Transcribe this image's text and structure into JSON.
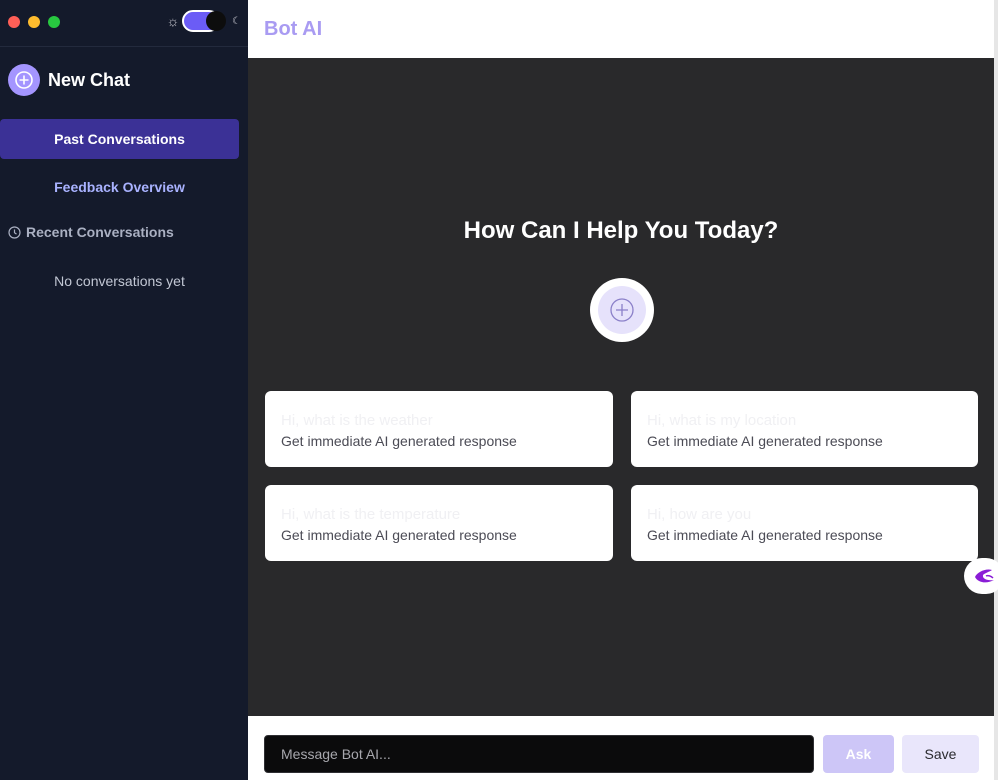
{
  "sidebar": {
    "new_chat": "New Chat",
    "nav": {
      "past": "Past Conversations",
      "feedback": "Feedback Overview"
    },
    "recent_label": "Recent Conversations",
    "empty": "No conversations yet",
    "theme": {
      "mode": "dark"
    }
  },
  "header": {
    "title": "Bot AI"
  },
  "main": {
    "heading": "How Can I Help You Today?",
    "cards": [
      {
        "question": "Hi, what is the weather",
        "subtitle": "Get immediate AI generated response"
      },
      {
        "question": "Hi, what is my location",
        "subtitle": "Get immediate AI generated response"
      },
      {
        "question": "Hi, what is the temperature",
        "subtitle": "Get immediate AI generated response"
      },
      {
        "question": "Hi, how are you",
        "subtitle": "Get immediate AI generated response"
      }
    ]
  },
  "composer": {
    "placeholder": "Message Bot AI...",
    "ask": "Ask",
    "save": "Save"
  },
  "colors": {
    "accent": "#6b5cf6",
    "sidebar": "#141a2b",
    "main": "#29292b",
    "title": "#a99bf2"
  }
}
